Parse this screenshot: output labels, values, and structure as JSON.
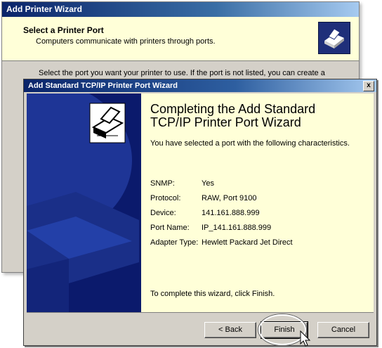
{
  "background_window": {
    "title": "Add Printer Wizard",
    "header_title": "Select a Printer Port",
    "header_subtitle": "Computers communicate with printers through ports.",
    "body_text": "Select the port you want your printer to use.  If the port is not listed, you can create a",
    "header_icon": "printer-icon"
  },
  "dialog": {
    "title": "Add Standard TCP/IP Printer Port Wizard",
    "close_label": "x",
    "sidebar_icon": "printer-document-icon",
    "heading_line1": "Completing the Add Standard",
    "heading_line2": "TCP/IP Printer Port Wizard",
    "intro": "You have selected a port with the following characteristics.",
    "details": [
      {
        "label": "SNMP:",
        "value": "Yes"
      },
      {
        "label": "Protocol:",
        "value": "RAW, Port 9100"
      },
      {
        "label": "Device:",
        "value": "141.161.888.999"
      },
      {
        "label": "Port Name:",
        "value": "IP_141.161.888.999"
      },
      {
        "label": "Adapter Type:",
        "value": "Hewlett Packard Jet Direct"
      }
    ],
    "finish_note": "To complete this wizard, click Finish.",
    "buttons": {
      "back": "< Back",
      "finish": "Finish",
      "cancel": "Cancel"
    }
  },
  "colors": {
    "title_bar": "#0a246a",
    "wizard_panel": "#ffffd8",
    "sidebar": "#0b1a6c",
    "face": "#d4d0c8"
  }
}
